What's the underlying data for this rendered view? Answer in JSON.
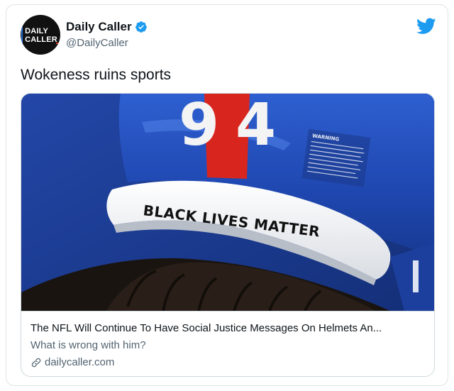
{
  "author": {
    "display_name": "Daily Caller",
    "handle": "@DailyCaller",
    "avatar_text_line1": "DAILY",
    "avatar_text_line2": "CALLER",
    "verified": true
  },
  "tweet": {
    "text": "Wokeness ruins sports"
  },
  "card": {
    "image": {
      "helmet_number_left": "9",
      "helmet_number_right": "4",
      "helmet_text": "BLACK LIVES MATTER",
      "sticker_text": "WARNING"
    },
    "title": "The NFL Will Continue To Have Social Justice Messages On Helmets An...",
    "description": "What is wrong with him?",
    "domain": "dailycaller.com"
  },
  "icons": {
    "verified": "verified-badge-icon",
    "platform": "twitter-bird-icon",
    "link": "link-icon"
  },
  "colors": {
    "twitter_blue": "#1d9bf0",
    "secondary_text": "#536471",
    "border": "#cfd9de",
    "helmet_blue": "#1f3f97"
  }
}
